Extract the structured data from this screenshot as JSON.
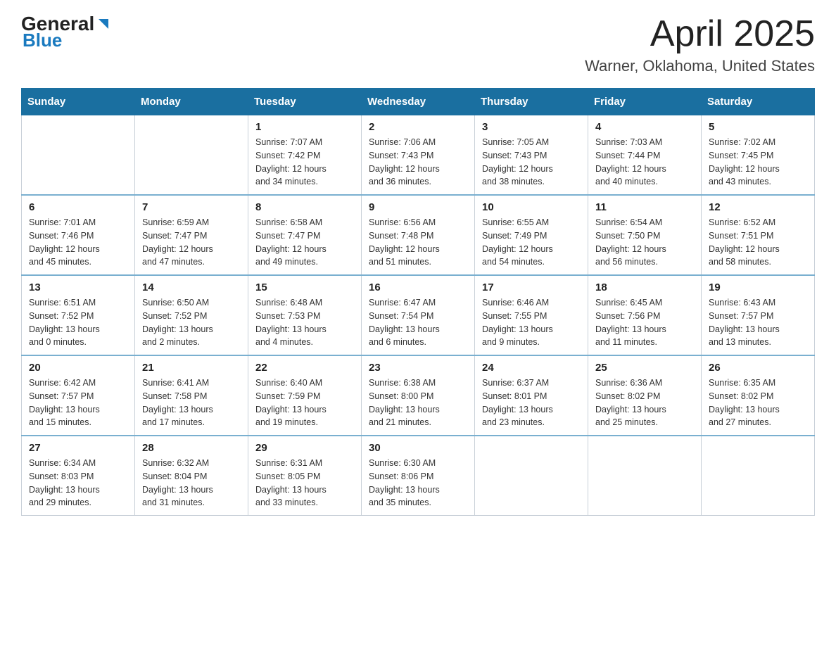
{
  "header": {
    "logo_text_general": "General",
    "logo_text_blue": "Blue",
    "title": "April 2025",
    "subtitle": "Warner, Oklahoma, United States"
  },
  "calendar": {
    "days_of_week": [
      "Sunday",
      "Monday",
      "Tuesday",
      "Wednesday",
      "Thursday",
      "Friday",
      "Saturday"
    ],
    "weeks": [
      [
        {
          "day": "",
          "info": ""
        },
        {
          "day": "",
          "info": ""
        },
        {
          "day": "1",
          "info": "Sunrise: 7:07 AM\nSunset: 7:42 PM\nDaylight: 12 hours\nand 34 minutes."
        },
        {
          "day": "2",
          "info": "Sunrise: 7:06 AM\nSunset: 7:43 PM\nDaylight: 12 hours\nand 36 minutes."
        },
        {
          "day": "3",
          "info": "Sunrise: 7:05 AM\nSunset: 7:43 PM\nDaylight: 12 hours\nand 38 minutes."
        },
        {
          "day": "4",
          "info": "Sunrise: 7:03 AM\nSunset: 7:44 PM\nDaylight: 12 hours\nand 40 minutes."
        },
        {
          "day": "5",
          "info": "Sunrise: 7:02 AM\nSunset: 7:45 PM\nDaylight: 12 hours\nand 43 minutes."
        }
      ],
      [
        {
          "day": "6",
          "info": "Sunrise: 7:01 AM\nSunset: 7:46 PM\nDaylight: 12 hours\nand 45 minutes."
        },
        {
          "day": "7",
          "info": "Sunrise: 6:59 AM\nSunset: 7:47 PM\nDaylight: 12 hours\nand 47 minutes."
        },
        {
          "day": "8",
          "info": "Sunrise: 6:58 AM\nSunset: 7:47 PM\nDaylight: 12 hours\nand 49 minutes."
        },
        {
          "day": "9",
          "info": "Sunrise: 6:56 AM\nSunset: 7:48 PM\nDaylight: 12 hours\nand 51 minutes."
        },
        {
          "day": "10",
          "info": "Sunrise: 6:55 AM\nSunset: 7:49 PM\nDaylight: 12 hours\nand 54 minutes."
        },
        {
          "day": "11",
          "info": "Sunrise: 6:54 AM\nSunset: 7:50 PM\nDaylight: 12 hours\nand 56 minutes."
        },
        {
          "day": "12",
          "info": "Sunrise: 6:52 AM\nSunset: 7:51 PM\nDaylight: 12 hours\nand 58 minutes."
        }
      ],
      [
        {
          "day": "13",
          "info": "Sunrise: 6:51 AM\nSunset: 7:52 PM\nDaylight: 13 hours\nand 0 minutes."
        },
        {
          "day": "14",
          "info": "Sunrise: 6:50 AM\nSunset: 7:52 PM\nDaylight: 13 hours\nand 2 minutes."
        },
        {
          "day": "15",
          "info": "Sunrise: 6:48 AM\nSunset: 7:53 PM\nDaylight: 13 hours\nand 4 minutes."
        },
        {
          "day": "16",
          "info": "Sunrise: 6:47 AM\nSunset: 7:54 PM\nDaylight: 13 hours\nand 6 minutes."
        },
        {
          "day": "17",
          "info": "Sunrise: 6:46 AM\nSunset: 7:55 PM\nDaylight: 13 hours\nand 9 minutes."
        },
        {
          "day": "18",
          "info": "Sunrise: 6:45 AM\nSunset: 7:56 PM\nDaylight: 13 hours\nand 11 minutes."
        },
        {
          "day": "19",
          "info": "Sunrise: 6:43 AM\nSunset: 7:57 PM\nDaylight: 13 hours\nand 13 minutes."
        }
      ],
      [
        {
          "day": "20",
          "info": "Sunrise: 6:42 AM\nSunset: 7:57 PM\nDaylight: 13 hours\nand 15 minutes."
        },
        {
          "day": "21",
          "info": "Sunrise: 6:41 AM\nSunset: 7:58 PM\nDaylight: 13 hours\nand 17 minutes."
        },
        {
          "day": "22",
          "info": "Sunrise: 6:40 AM\nSunset: 7:59 PM\nDaylight: 13 hours\nand 19 minutes."
        },
        {
          "day": "23",
          "info": "Sunrise: 6:38 AM\nSunset: 8:00 PM\nDaylight: 13 hours\nand 21 minutes."
        },
        {
          "day": "24",
          "info": "Sunrise: 6:37 AM\nSunset: 8:01 PM\nDaylight: 13 hours\nand 23 minutes."
        },
        {
          "day": "25",
          "info": "Sunrise: 6:36 AM\nSunset: 8:02 PM\nDaylight: 13 hours\nand 25 minutes."
        },
        {
          "day": "26",
          "info": "Sunrise: 6:35 AM\nSunset: 8:02 PM\nDaylight: 13 hours\nand 27 minutes."
        }
      ],
      [
        {
          "day": "27",
          "info": "Sunrise: 6:34 AM\nSunset: 8:03 PM\nDaylight: 13 hours\nand 29 minutes."
        },
        {
          "day": "28",
          "info": "Sunrise: 6:32 AM\nSunset: 8:04 PM\nDaylight: 13 hours\nand 31 minutes."
        },
        {
          "day": "29",
          "info": "Sunrise: 6:31 AM\nSunset: 8:05 PM\nDaylight: 13 hours\nand 33 minutes."
        },
        {
          "day": "30",
          "info": "Sunrise: 6:30 AM\nSunset: 8:06 PM\nDaylight: 13 hours\nand 35 minutes."
        },
        {
          "day": "",
          "info": ""
        },
        {
          "day": "",
          "info": ""
        },
        {
          "day": "",
          "info": ""
        }
      ]
    ]
  }
}
